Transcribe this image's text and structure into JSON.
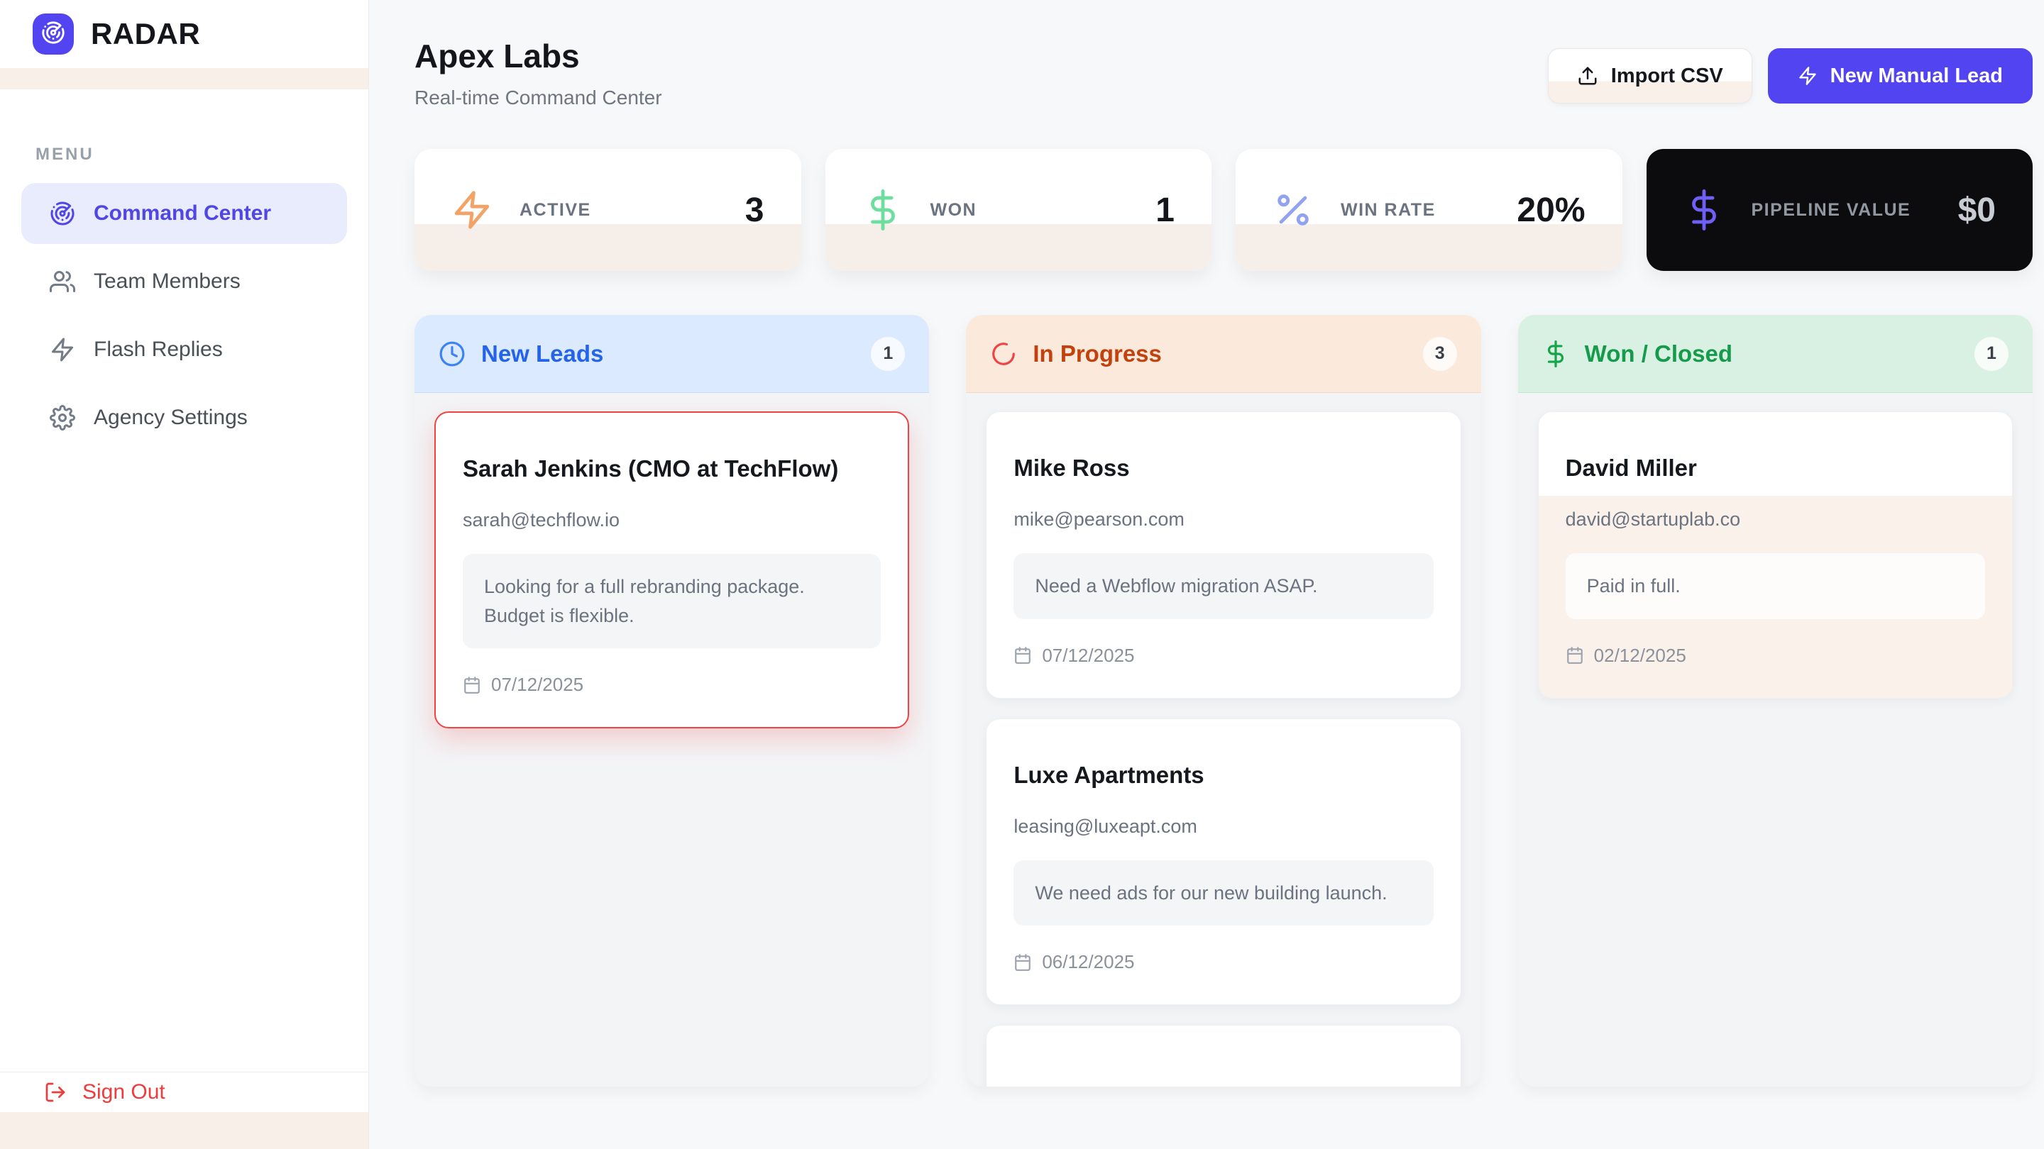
{
  "app": {
    "name": "RADAR"
  },
  "sidebar": {
    "menu_label": "MENU",
    "items": [
      {
        "label": "Command Center",
        "icon": "radar-icon",
        "active": true
      },
      {
        "label": "Team Members",
        "icon": "users-icon",
        "active": false
      },
      {
        "label": "Flash Replies",
        "icon": "zap-icon",
        "active": false
      },
      {
        "label": "Agency Settings",
        "icon": "gear-icon",
        "active": false
      }
    ],
    "sign_out_label": "Sign Out"
  },
  "header": {
    "title": "Apex Labs",
    "subtitle": "Real-time Command Center",
    "import_csv_label": "Import CSV",
    "new_lead_label": "New Manual Lead"
  },
  "stats": [
    {
      "label": "ACTIVE",
      "value": "3",
      "icon": "zap-icon",
      "icon_color": "#f2a368",
      "theme": "light"
    },
    {
      "label": "WON",
      "value": "1",
      "icon": "dollar-icon",
      "icon_color": "#6ede9e",
      "theme": "light"
    },
    {
      "label": "WIN RATE",
      "value": "20%",
      "icon": "percent-icon",
      "icon_color": "#92a2f2",
      "theme": "light"
    },
    {
      "label": "PIPELINE VALUE",
      "value": "$0",
      "icon": "dollar-icon",
      "icon_color": "#6f5ff5",
      "theme": "dark"
    }
  ],
  "board": {
    "columns": [
      {
        "title": "New Leads",
        "count": "1",
        "icon": "clock-icon",
        "theme": "blue",
        "cards": [
          {
            "name": "Sarah Jenkins (CMO at TechFlow)",
            "email": "sarah@techflow.io",
            "note": "Looking for a full rebranding package. Budget is flexible.",
            "date": "07/12/2025",
            "highlight": true
          }
        ]
      },
      {
        "title": "In Progress",
        "count": "3",
        "icon": "loader-icon",
        "theme": "orange",
        "cards": [
          {
            "name": "Mike Ross",
            "email": "mike@pearson.com",
            "note": "Need a Webflow migration ASAP.",
            "date": "07/12/2025"
          },
          {
            "name": "Luxe Apartments",
            "email": "leasing@luxeapt.com",
            "note": "We need ads for our new building launch.",
            "date": "06/12/2025"
          },
          {
            "partial": true
          }
        ]
      },
      {
        "title": "Won / Closed",
        "count": "1",
        "icon": "dollar-icon",
        "theme": "green",
        "cards": [
          {
            "name": "David Miller",
            "email": "david@startuplab.co",
            "note": "Paid in full.",
            "date": "02/12/2025",
            "won": true
          }
        ]
      }
    ]
  },
  "colors": {
    "brand_purple": "#5244f0",
    "active_nav_bg": "#e9ecfd",
    "accent_strip": "#f7efe8",
    "new_leads_bg": "#dbeafe",
    "new_leads_text": "#2563eb",
    "in_progress_bg": "#fbe9dc",
    "in_progress_text": "#c2410c",
    "won_closed_bg": "#d9f1e3",
    "won_closed_text": "#169a4b",
    "highlight_red": "#ef4444",
    "signout_red": "#ef3b3b",
    "dark_card_bg": "#0c0c0e"
  }
}
